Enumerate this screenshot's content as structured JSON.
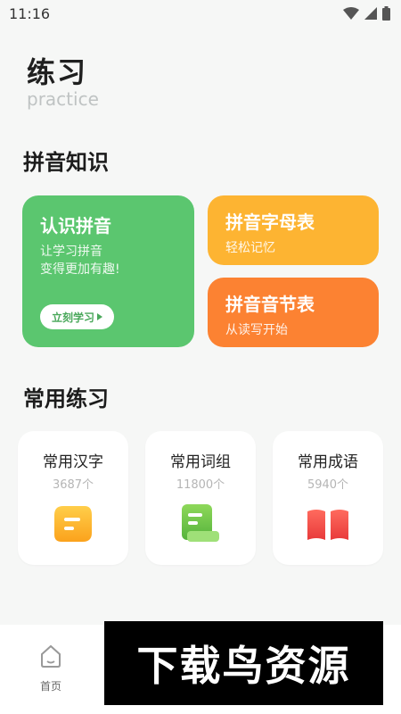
{
  "status": {
    "time": "11:16"
  },
  "header": {
    "title": "练习",
    "subtitle": "practice"
  },
  "sections": {
    "pinyin": "拼音知识",
    "common": "常用练习"
  },
  "cards": {
    "learn": {
      "title": "认识拼音",
      "line1": "让学习拼音",
      "line2": "变得更加有趣!",
      "button": "立刻学习"
    },
    "alphabet": {
      "title": "拼音字母表",
      "sub": "轻松记忆"
    },
    "syllable": {
      "title": "拼音音节表",
      "sub": "从读写开始"
    }
  },
  "tiles": [
    {
      "title": "常用汉字",
      "count": "3687个",
      "icon": "chat-bubble-icon",
      "color": "#fdb432"
    },
    {
      "title": "常用词组",
      "count": "11800个",
      "icon": "scroll-icon",
      "color": "#6cc24a"
    },
    {
      "title": "常用成语",
      "count": "5940个",
      "icon": "book-icon",
      "color": "#f24a4a"
    }
  ],
  "nav": {
    "home": "首页"
  },
  "watermark": "下载鸟资源",
  "colors": {
    "green": "#5bc66f",
    "yellow": "#fdb432",
    "orange": "#fc8232"
  }
}
